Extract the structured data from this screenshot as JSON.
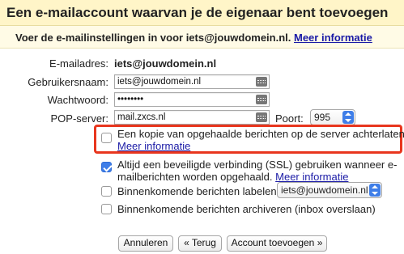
{
  "header": {
    "title": "Een e-mailaccount waarvan je de eigenaar bent toevoegen"
  },
  "intro": {
    "text": "Voer de e-mailinstellingen in voor iets@jouwdomein.nl.",
    "link": "Meer informatie"
  },
  "form": {
    "email_label": "E-mailadres:",
    "email_value": "iets@jouwdomein.nl",
    "username_label": "Gebruikersnaam:",
    "username_value": "iets@jouwdomein.nl",
    "password_label": "Wachtwoord:",
    "password_value": "••••••••",
    "pop_label": "POP-server:",
    "pop_value": "mail.zxcs.nl",
    "port_label": "Poort:",
    "port_value": "995"
  },
  "options": {
    "leave_copy": {
      "label": "Een kopie van opgehaalde berichten op de server achterlaten.",
      "link": "Meer informatie",
      "checked": false
    },
    "ssl": {
      "label_line1": "Altijd een beveiligde verbinding (SSL) gebruiken wanneer e-",
      "label_line2": "mailberichten worden opgehaald.",
      "link": "Meer informatie",
      "checked": true
    },
    "label_incoming": {
      "label": "Binnenkomende berichten labelen:",
      "select_value": "iets@jouwdomein.nl",
      "checked": false
    },
    "archive": {
      "label": "Binnenkomende berichten archiveren (inbox overslaan)",
      "checked": false
    }
  },
  "buttons": {
    "cancel": "Annuleren",
    "back": "« Terug",
    "add": "Account toevoegen »"
  },
  "colors": {
    "header_bg": "#fff5c8",
    "link": "#1a1aa6",
    "highlight": "#e8361e",
    "checkbox_checked": "#3f7ee8"
  }
}
